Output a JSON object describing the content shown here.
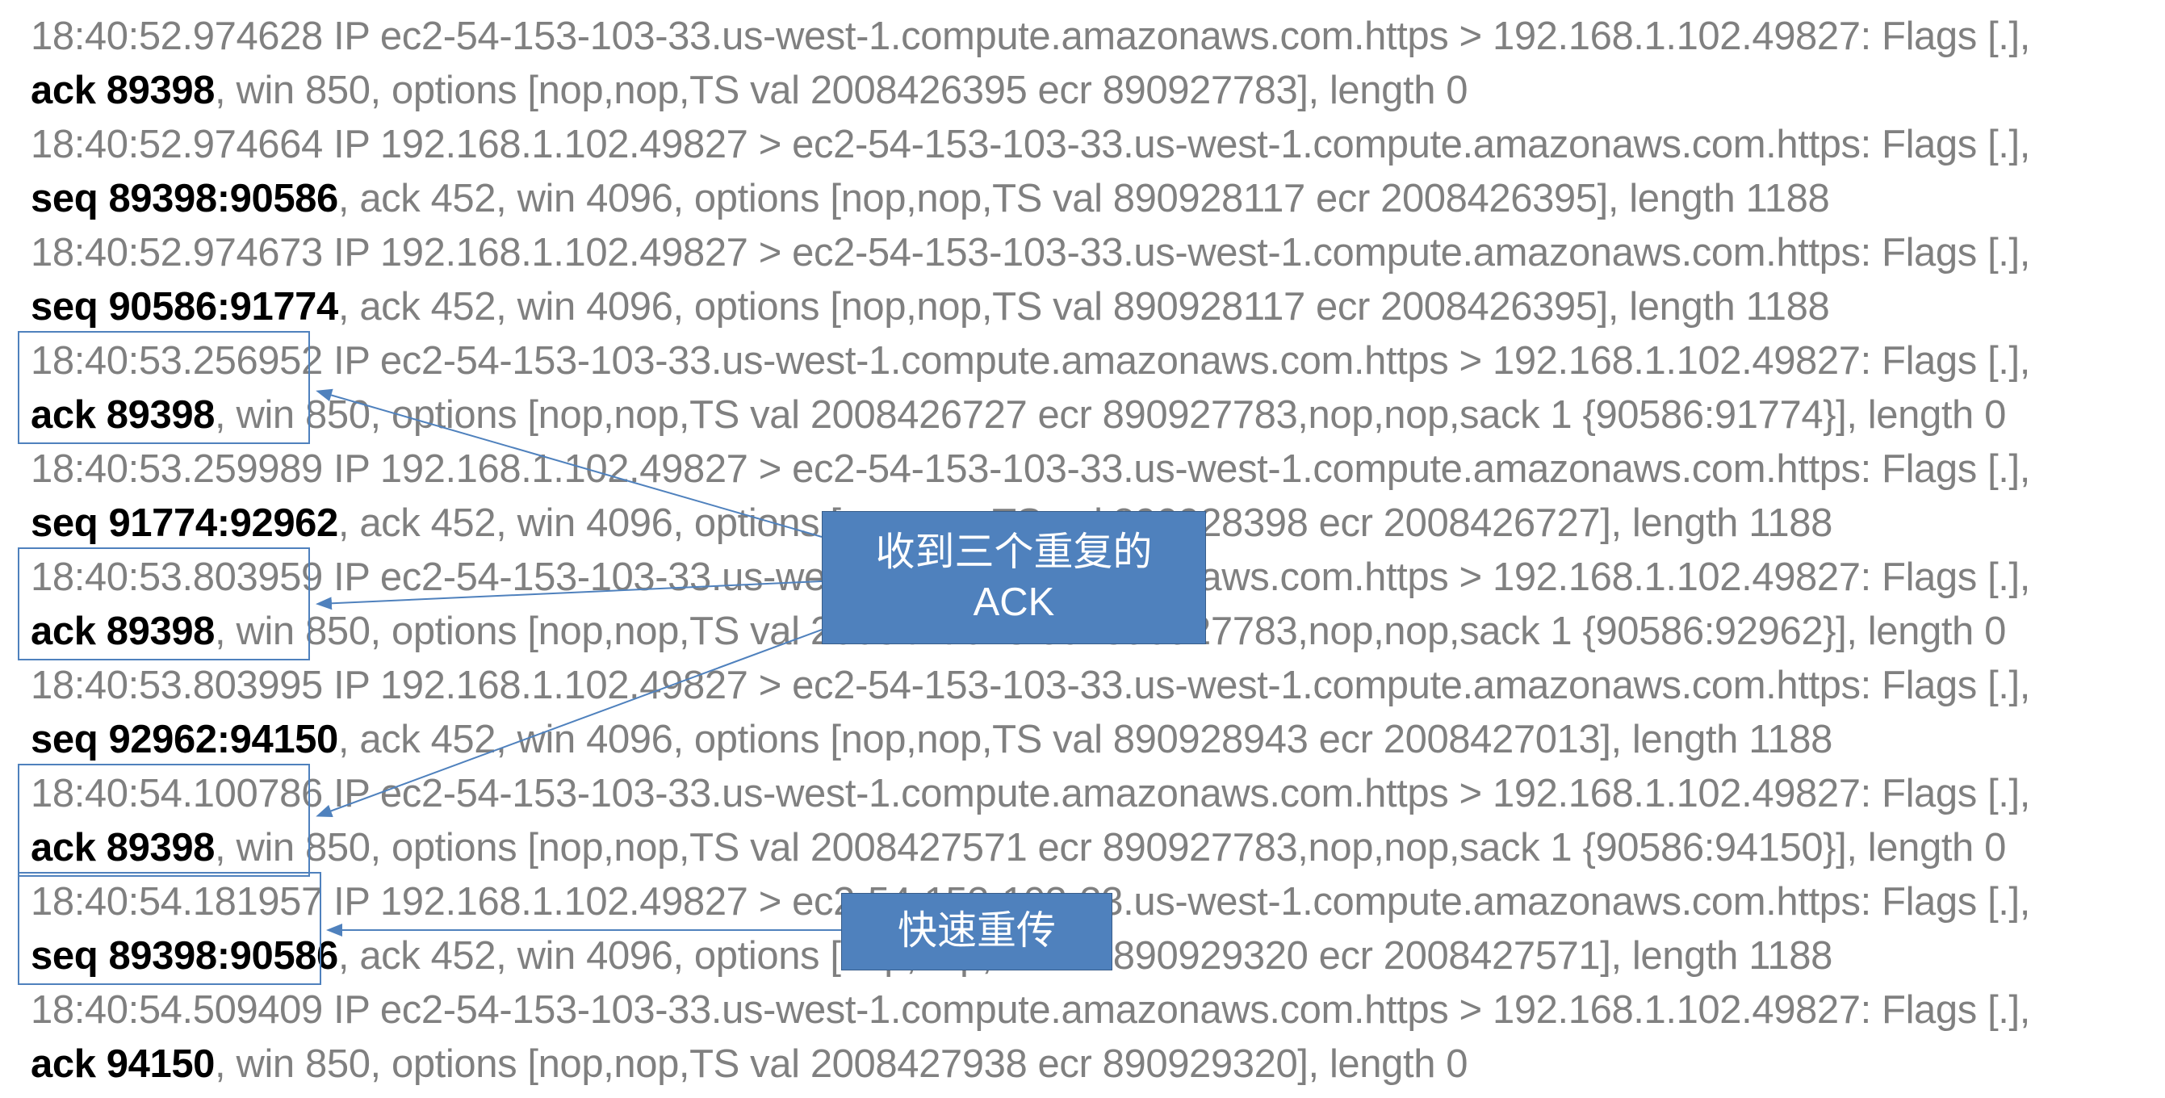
{
  "lines": [
    {
      "gray": "18:40:52.974628 IP ec2-54-153-103-33.us-west-1.compute.amazonaws.com.https > 192.168.1.102.49827: Flags [.],",
      "bold": ""
    },
    {
      "gray": ", win 850, options [nop,nop,TS val 2008426395 ecr 890927783], length 0",
      "bold": "ack 89398"
    },
    {
      "gray": "18:40:52.974664 IP 192.168.1.102.49827 > ec2-54-153-103-33.us-west-1.compute.amazonaws.com.https: Flags [.],",
      "bold": ""
    },
    {
      "gray": ", ack 452, win 4096, options [nop,nop,TS val 890928117 ecr 2008426395], length 1188",
      "bold": "seq 89398:90586"
    },
    {
      "gray": "18:40:52.974673 IP 192.168.1.102.49827 > ec2-54-153-103-33.us-west-1.compute.amazonaws.com.https: Flags [.],",
      "bold": ""
    },
    {
      "gray": ", ack 452, win 4096, options [nop,nop,TS val 890928117 ecr 2008426395], length 1188",
      "bold": "seq 90586:91774"
    },
    {
      "gray": "18:40:53.256952 IP ec2-54-153-103-33.us-west-1.compute.amazonaws.com.https > 192.168.1.102.49827: Flags [.],",
      "bold": ""
    },
    {
      "gray": ", win 850, options [nop,nop,TS val 2008426727 ecr 890927783,nop,nop,sack 1 {90586:91774}], length 0",
      "bold": "ack 89398"
    },
    {
      "gray": "18:40:53.259989 IP 192.168.1.102.49827 > ec2-54-153-103-33.us-west-1.compute.amazonaws.com.https: Flags [.],",
      "bold": ""
    },
    {
      "gray": ", ack 452, win 4096, options [nop,nop,TS val 890928398 ecr 2008426727], length 1188",
      "bold": "seq 91774:92962"
    },
    {
      "gray": "18:40:53.803959 IP ec2-54-153-103-33.us-west-1.compute.amazonaws.com.https > 192.168.1.102.49827: Flags [.],",
      "bold": ""
    },
    {
      "gray": ", win 850, options [nop,nop,TS val 2008427013 ecr 890927783,nop,nop,sack 1 {90586:92962}], length 0",
      "bold": "ack 89398"
    },
    {
      "gray": "18:40:53.803995 IP 192.168.1.102.49827 > ec2-54-153-103-33.us-west-1.compute.amazonaws.com.https: Flags [.],",
      "bold": ""
    },
    {
      "gray": ", ack 452, win 4096, options [nop,nop,TS val 890928943 ecr 2008427013], length 1188",
      "bold": "seq 92962:94150"
    },
    {
      "gray": "18:40:54.100786 IP ec2-54-153-103-33.us-west-1.compute.amazonaws.com.https > 192.168.1.102.49827: Flags [.],",
      "bold": ""
    },
    {
      "gray": ", win 850, options [nop,nop,TS val 2008427571 ecr 890927783,nop,nop,sack 1 {90586:94150}], length 0",
      "bold": "ack 89398"
    },
    {
      "gray": "18:40:54.181957 IP 192.168.1.102.49827 > ec2-54-153-103-33.us-west-1.compute.amazonaws.com.https: Flags [.],",
      "bold": ""
    },
    {
      "gray": ", ack 452, win 4096, options [nop,nop,TS val 890929320 ecr 2008427571], length 1188",
      "bold": "seq 89398:90586"
    },
    {
      "gray": "18:40:54.509409 IP ec2-54-153-103-33.us-west-1.compute.amazonaws.com.https > 192.168.1.102.49827: Flags [.],",
      "bold": ""
    },
    {
      "gray": ", win 850, options [nop,nop,TS val 2008427938 ecr 890929320], length 0",
      "bold": "ack 94150"
    }
  ],
  "callouts": {
    "dupAck": "收到三个重复的\nACK",
    "fastRetrans": "快速重传"
  },
  "colors": {
    "callout_bg": "#4F81BD",
    "callout_border": "#385D8A",
    "gray_text": "#808080",
    "bold_text": "#000000"
  }
}
